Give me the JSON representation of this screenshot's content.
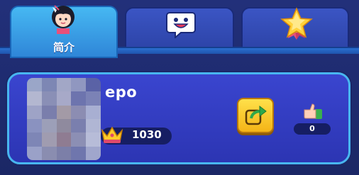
{
  "tabs": [
    {
      "label": "简介",
      "icon": "girl-avatar-icon",
      "active": true
    },
    {
      "label": "",
      "icon": "chat-face-icon",
      "active": false
    },
    {
      "label": "",
      "icon": "star-badge-icon",
      "active": false
    }
  ],
  "profile": {
    "name": "epo",
    "avatar": "blurred-avatar",
    "score": "1030",
    "score_icon": "crown-icon",
    "likes": "0",
    "like_icon": "thumbs-up-icon",
    "share_icon": "share-icon"
  },
  "colors": {
    "background": "#1c2a6e",
    "tab_active": "#2f86d8",
    "tab_inactive": "#2d44a8",
    "card": "#2c35b3",
    "card_border": "#48b6f0",
    "share_button": "#f4b417"
  }
}
